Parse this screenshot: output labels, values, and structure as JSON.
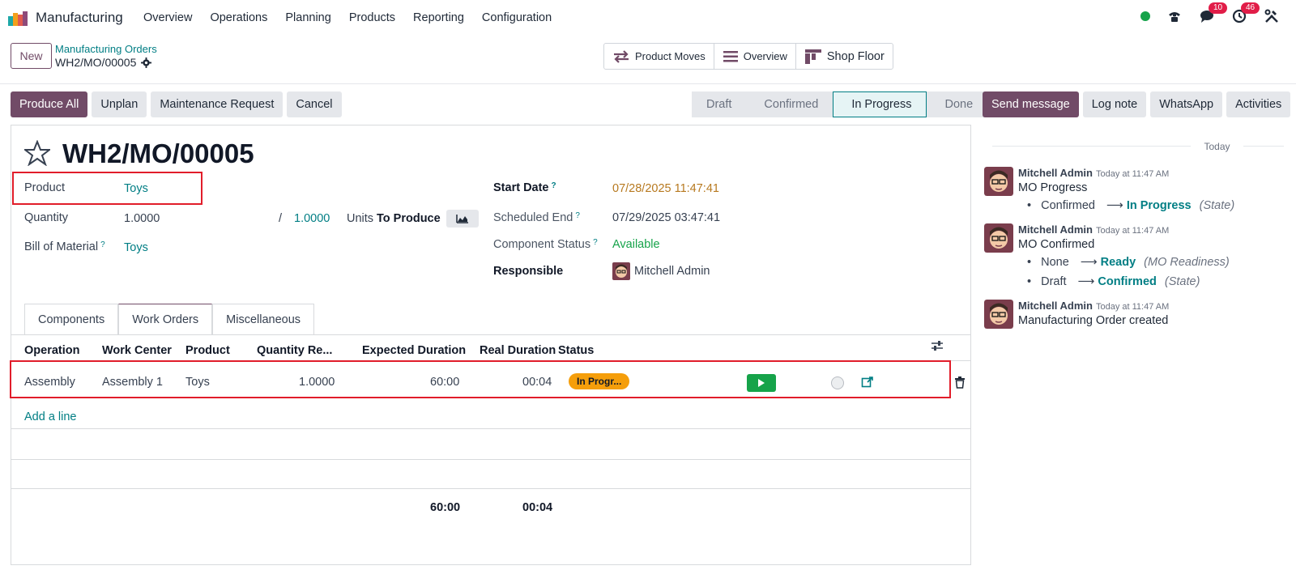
{
  "app": {
    "name": "Manufacturing"
  },
  "menu": [
    "Overview",
    "Operations",
    "Planning",
    "Products",
    "Reporting",
    "Configuration"
  ],
  "systray": {
    "messages_count": "10",
    "activities_count": "46"
  },
  "control_panel": {
    "new_label": "New",
    "breadcrumb_parent": "Manufacturing Orders",
    "breadcrumb_current": "WH2/MO/00005",
    "smart_buttons": [
      "Product Moves",
      "Overview",
      "Shop Floor"
    ]
  },
  "actions": [
    "Produce All",
    "Unplan",
    "Maintenance Request",
    "Cancel"
  ],
  "statusbar": [
    "Draft",
    "Confirmed",
    "In Progress",
    "Done"
  ],
  "chatter_buttons": [
    "Send message",
    "Log note",
    "WhatsApp",
    "Activities"
  ],
  "form": {
    "title": "WH2/MO/00005",
    "product_label": "Product",
    "product_value": "Toys",
    "quantity_label": "Quantity",
    "quantity_value": "1.0000",
    "quantity_sep": "/",
    "quantity_max": "1.0000",
    "units_label": "Units",
    "to_produce_label": "To Produce",
    "bom_label": "Bill of Material",
    "bom_value": "Toys",
    "start_date_label": "Start Date",
    "start_date_value": "07/28/2025 11:47:41",
    "scheduled_end_label": "Scheduled End",
    "scheduled_end_value": "07/29/2025 03:47:41",
    "component_status_label": "Component Status",
    "component_status_value": "Available",
    "responsible_label": "Responsible",
    "responsible_value": "Mitchell Admin",
    "help_mark": "?"
  },
  "tabs": [
    "Components",
    "Work Orders",
    "Miscellaneous"
  ],
  "workorders": {
    "headers": [
      "Operation",
      "Work Center",
      "Product",
      "Quantity Re...",
      "Expected Duration",
      "Real Duration",
      "Status"
    ],
    "row": {
      "operation": "Assembly",
      "work_center": "Assembly 1",
      "product": "Toys",
      "quantity": "1.0000",
      "expected": "60:00",
      "real": "00:04",
      "status": "In Progr..."
    },
    "add_line": "Add a line",
    "total_expected": "60:00",
    "total_real": "00:04"
  },
  "chatter": {
    "today": "Today",
    "messages": [
      {
        "author": "Mitchell Admin",
        "time": "Today at 11:47 AM",
        "body": "MO Progress",
        "tracks": [
          {
            "old": "Confirmed",
            "new": "In Progress",
            "field": "(State)"
          }
        ]
      },
      {
        "author": "Mitchell Admin",
        "time": "Today at 11:47 AM",
        "body": "MO Confirmed",
        "tracks": [
          {
            "old": "None",
            "new": "Ready",
            "field": "(MO Readiness)"
          },
          {
            "old": "Draft",
            "new": "Confirmed",
            "field": "(State)"
          }
        ]
      },
      {
        "author": "Mitchell Admin",
        "time": "Today at 11:47 AM",
        "body": "Manufacturing Order created",
        "tracks": []
      }
    ]
  },
  "colors": {
    "primary": "#714b67",
    "link": "#017e84",
    "highlight": "#e11d2a",
    "status_pill": "#f59e0b"
  }
}
